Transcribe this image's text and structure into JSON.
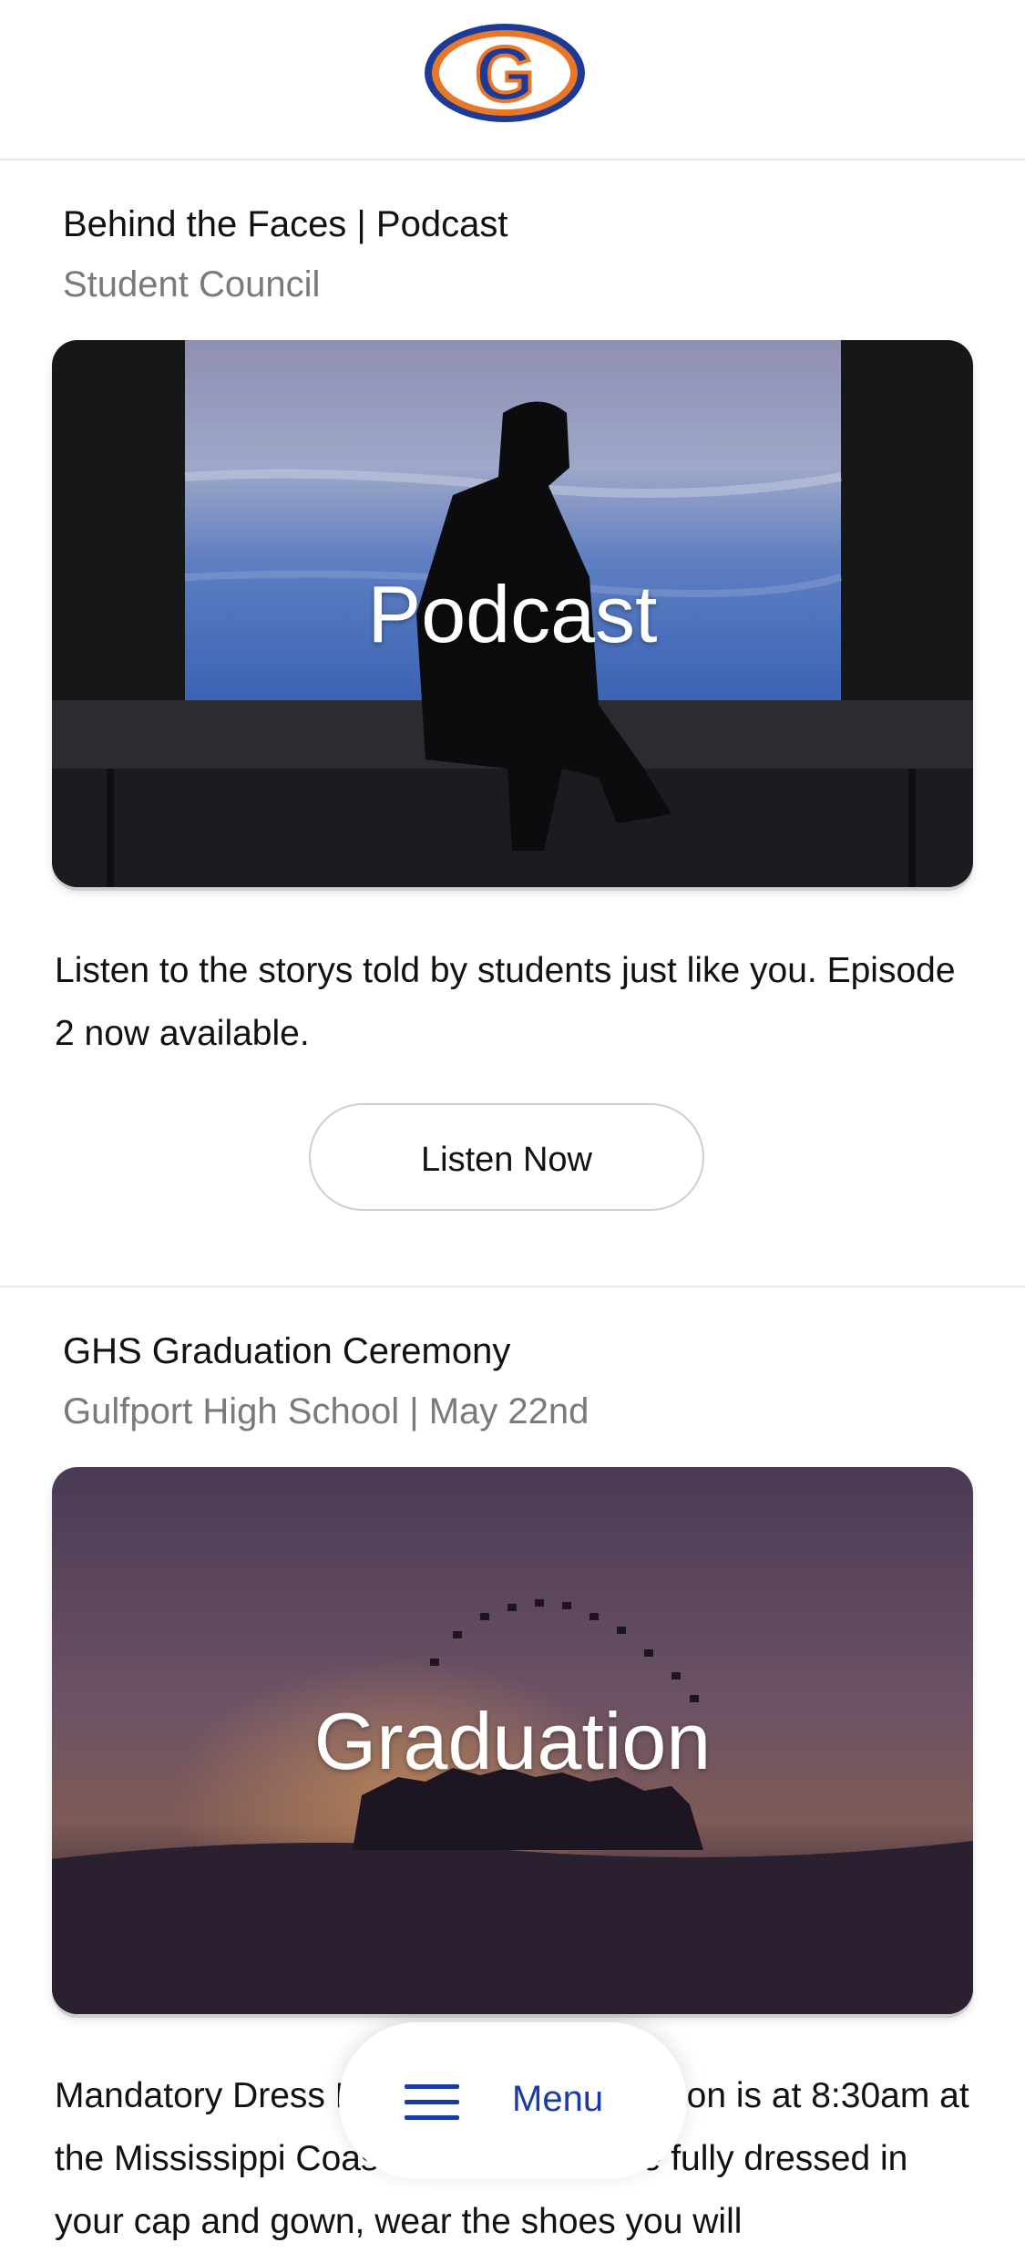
{
  "header": {
    "logo_letter": "G",
    "logo_colors": {
      "outer": "#1c3a96",
      "ring": "#e8772a"
    }
  },
  "posts": [
    {
      "title": "Behind the Faces | Podcast",
      "subtitle": "Student Council",
      "image_label": "Podcast",
      "description": "Listen to the storys told by students just like you. Episode 2 now available.",
      "button_label": "Listen Now"
    },
    {
      "title": "GHS Graduation Ceremony",
      "subtitle": "Gulfport High School | May 22nd",
      "image_label": "Graduation",
      "description": "Mandatory Dress Rehearsal for graduation is at 8:30am at the Mississippi Coast Coliseum. Come fully dressed in your cap and gown, wear the shoes you will"
    }
  ],
  "bottom_nav": {
    "menu_label": "Menu",
    "menu_icon": "hamburger-icon"
  }
}
